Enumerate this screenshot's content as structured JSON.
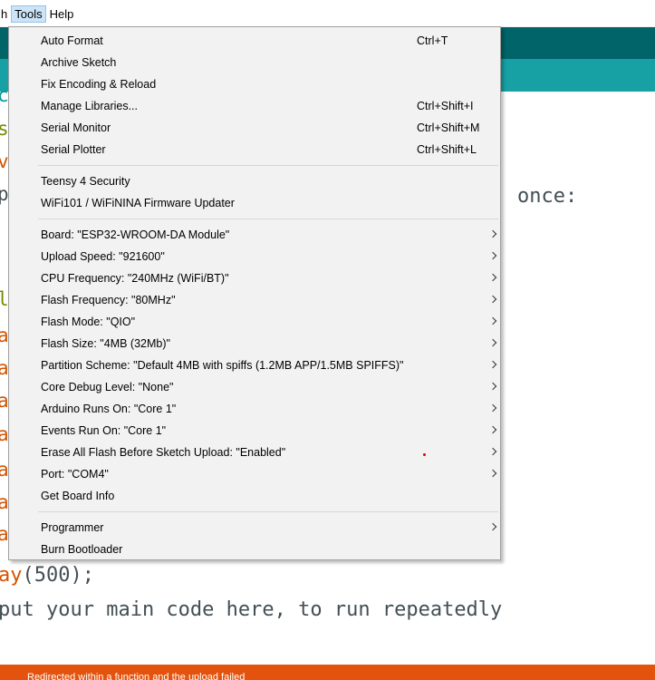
{
  "menubar": {
    "partial_label": "h",
    "items": [
      "Tools",
      "Help"
    ]
  },
  "editor": {
    "gutter_chars": [
      {
        "ch": "c",
        "color": "#00979c"
      },
      {
        "ch": "s",
        "color": "#728e00"
      },
      {
        "ch": "v",
        "color": "#d35400"
      },
      {
        "ch": "p",
        "color": "#434f54"
      },
      {
        "ch": "l",
        "color": "#728e00"
      },
      {
        "ch": "a",
        "color": "#d35400"
      },
      {
        "ch": "a",
        "color": "#d35400"
      },
      {
        "ch": "a",
        "color": "#d35400"
      },
      {
        "ch": "a",
        "color": "#d35400"
      },
      {
        "ch": "a",
        "color": "#d35400"
      },
      {
        "ch": "a",
        "color": "#d35400"
      },
      {
        "ch": "a",
        "color": "#d35400"
      }
    ],
    "right_text": "once:",
    "line_delay_fn": "ay",
    "line_delay_rest": "(500);",
    "line_comment": "put your main code here, to run repeatedly"
  },
  "status": {
    "text": "Redirected within a function and the upload failed"
  },
  "tools_menu": {
    "groups": [
      [
        {
          "label": "Auto Format",
          "shortcut": "Ctrl+T"
        },
        {
          "label": "Archive Sketch"
        },
        {
          "label": "Fix Encoding & Reload"
        },
        {
          "label": "Manage Libraries...",
          "shortcut": "Ctrl+Shift+I"
        },
        {
          "label": "Serial Monitor",
          "shortcut": "Ctrl+Shift+M"
        },
        {
          "label": "Serial Plotter",
          "shortcut": "Ctrl+Shift+L"
        }
      ],
      [
        {
          "label": "Teensy 4 Security"
        },
        {
          "label": "WiFi101 / WiFiNINA Firmware Updater"
        }
      ],
      [
        {
          "label": "Board: \"ESP32-WROOM-DA Module\"",
          "submenu": true
        },
        {
          "label": "Upload Speed: \"921600\"",
          "submenu": true
        },
        {
          "label": "CPU Frequency: \"240MHz (WiFi/BT)\"",
          "submenu": true
        },
        {
          "label": "Flash Frequency: \"80MHz\"",
          "submenu": true
        },
        {
          "label": "Flash Mode: \"QIO\"",
          "submenu": true
        },
        {
          "label": "Flash Size: \"4MB (32Mb)\"",
          "submenu": true
        },
        {
          "label": "Partition Scheme: \"Default 4MB with spiffs (1.2MB APP/1.5MB SPIFFS)\"",
          "submenu": true
        },
        {
          "label": "Core Debug Level: \"None\"",
          "submenu": true
        },
        {
          "label": "Arduino Runs On: \"Core 1\"",
          "submenu": true
        },
        {
          "label": "Events Run On: \"Core 1\"",
          "submenu": true
        },
        {
          "label": "Erase All Flash Before Sketch Upload: \"Enabled\"",
          "submenu": true
        },
        {
          "label": "Port: \"COM4\"",
          "submenu": true
        },
        {
          "label": "Get Board Info"
        }
      ],
      [
        {
          "label": "Programmer",
          "submenu": true
        },
        {
          "label": "Burn Bootloader"
        }
      ]
    ]
  }
}
